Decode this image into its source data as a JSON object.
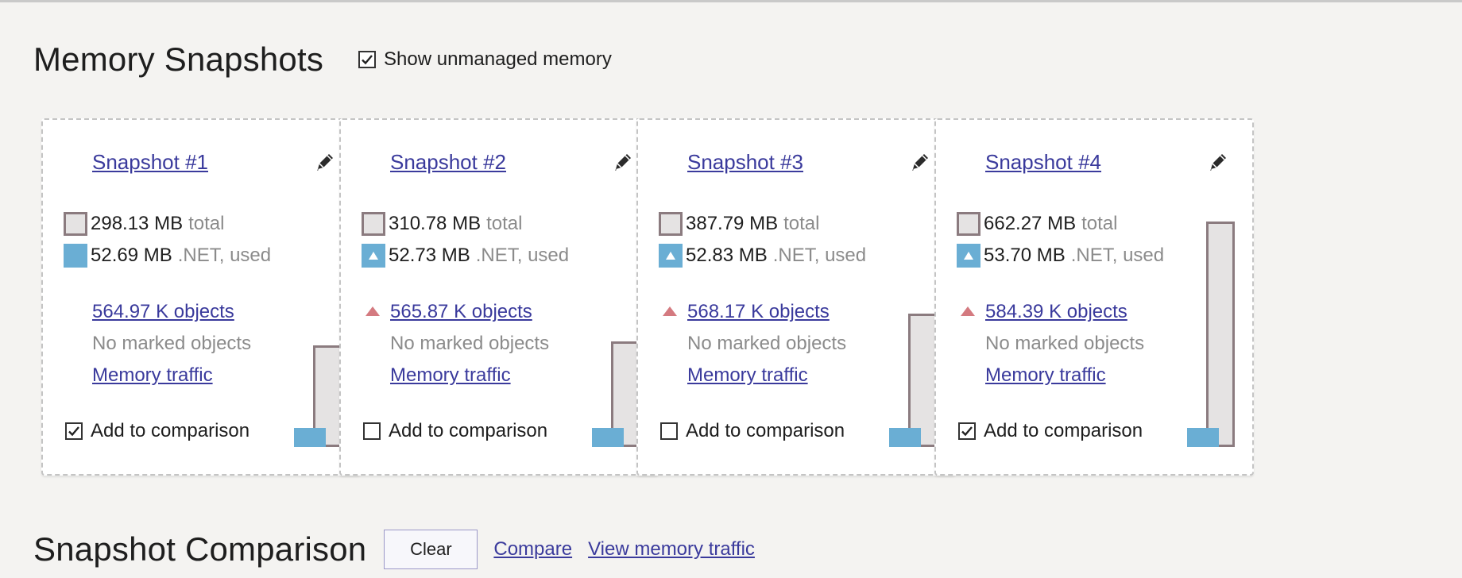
{
  "header": {
    "title": "Memory Snapshots",
    "show_unmanaged_label": "Show unmanaged memory",
    "show_unmanaged_checked": true
  },
  "colors": {
    "link": "#3a3a9c",
    "net_used": "#6aaed4",
    "total": "#e5e3e3",
    "total_border": "#8b7b7f",
    "increase_marker": "#d47a80"
  },
  "total_unit": "total",
  "net_unit": ".NET, used",
  "snapshots": [
    {
      "title": "Snapshot #1",
      "total": "298.13 MB",
      "net_used": "52.69 MB",
      "net_increase": false,
      "objects": "564.97 K objects",
      "objects_increase": false,
      "marked": "No marked objects",
      "traffic": "Memory traffic",
      "compare_label": "Add to comparison",
      "compare_checked": true,
      "total_bar_fraction": 0.45,
      "net_bar_fraction": 0.08
    },
    {
      "title": "Snapshot #2",
      "total": "310.78 MB",
      "net_used": "52.73 MB",
      "net_increase": true,
      "objects": "565.87 K objects",
      "objects_increase": true,
      "marked": "No marked objects",
      "traffic": "Memory traffic",
      "compare_label": "Add to comparison",
      "compare_checked": false,
      "total_bar_fraction": 0.47,
      "net_bar_fraction": 0.08
    },
    {
      "title": "Snapshot #3",
      "total": "387.79 MB",
      "net_used": "52.83 MB",
      "net_increase": true,
      "objects": "568.17 K objects",
      "objects_increase": true,
      "marked": "No marked objects",
      "traffic": "Memory traffic",
      "compare_label": "Add to comparison",
      "compare_checked": false,
      "total_bar_fraction": 0.59,
      "net_bar_fraction": 0.08
    },
    {
      "title": "Snapshot #4",
      "total": "662.27 MB",
      "net_used": "53.70 MB",
      "net_increase": true,
      "objects": "584.39 K objects",
      "objects_increase": true,
      "marked": "No marked objects",
      "traffic": "Memory traffic",
      "compare_label": "Add to comparison",
      "compare_checked": true,
      "total_bar_fraction": 1.0,
      "net_bar_fraction": 0.08
    }
  ],
  "comparison": {
    "title": "Snapshot Comparison",
    "clear_label": "Clear",
    "compare_label": "Compare",
    "view_traffic_label": "View memory traffic"
  }
}
